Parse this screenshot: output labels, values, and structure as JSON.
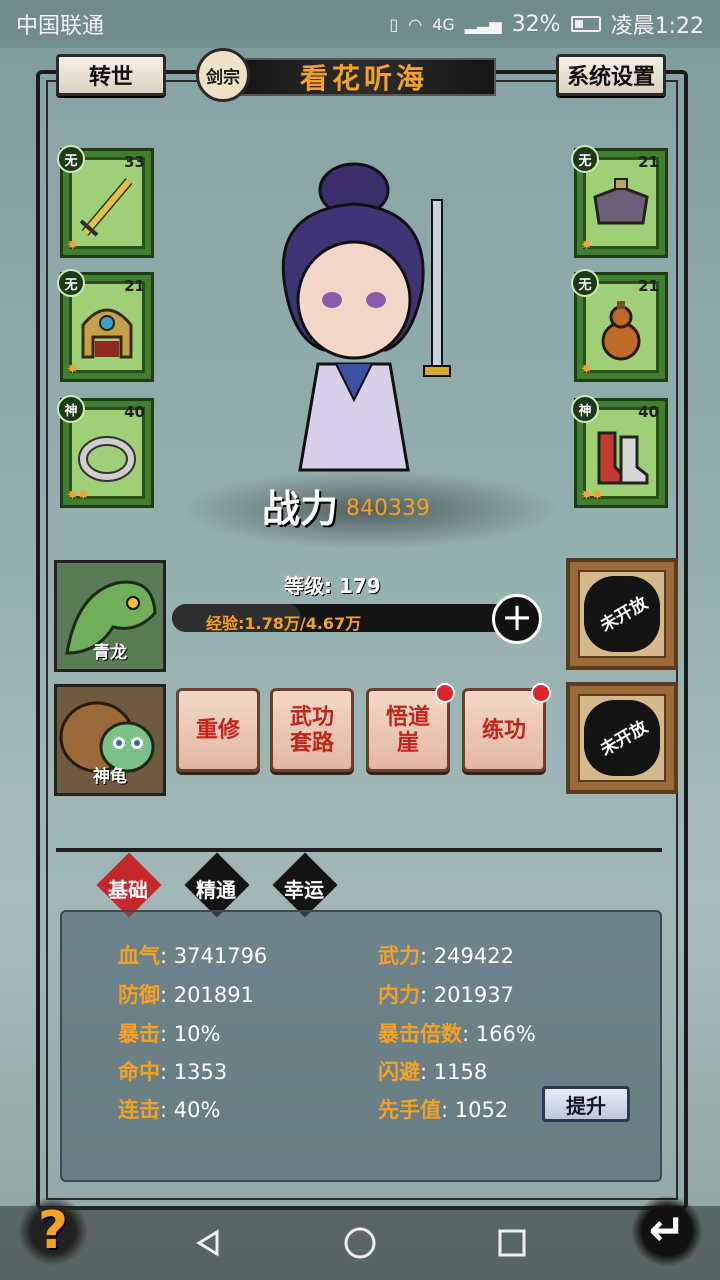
{
  "status_bar": {
    "carrier": "中国联通",
    "network": "4G",
    "battery": "32%",
    "time": "凌晨1:22"
  },
  "header": {
    "rebirth_label": "转世",
    "sect_label": "剑宗",
    "character_name": "看花听海",
    "settings_label": "系统设置"
  },
  "equipment": {
    "left": [
      {
        "rank": "无",
        "level": "33",
        "item": "sword-icon",
        "stars": 1
      },
      {
        "rank": "无",
        "level": "21",
        "item": "helmet-icon",
        "stars": 1
      },
      {
        "rank": "神",
        "level": "40",
        "item": "ring-icon",
        "stars": 2
      }
    ],
    "right": [
      {
        "rank": "无",
        "level": "21",
        "item": "armor-icon",
        "stars": 1
      },
      {
        "rank": "无",
        "level": "21",
        "item": "gourd-icon",
        "stars": 1
      },
      {
        "rank": "神",
        "level": "40",
        "item": "boots-icon",
        "stars": 2
      }
    ]
  },
  "power": {
    "label": "战力",
    "value": "840339"
  },
  "level": {
    "text": "等级: 179",
    "exp_text": "经验:1.78万/4.67万",
    "exp_progress": 0.38
  },
  "pets": [
    {
      "name": "青龙",
      "icon": "dragon-icon"
    },
    {
      "name": "神龟",
      "icon": "turtle-icon"
    }
  ],
  "actions": [
    {
      "label": "重修",
      "dot": false
    },
    {
      "label": "武功套路",
      "dot": false
    },
    {
      "label": "悟道崖",
      "dot": true
    },
    {
      "label": "练功",
      "dot": true
    }
  ],
  "locked_slots": [
    {
      "label": "未开放"
    },
    {
      "label": "未开放"
    }
  ],
  "tabs": [
    {
      "label": "基础",
      "active": true
    },
    {
      "label": "精通",
      "active": false
    },
    {
      "label": "幸运",
      "active": false
    }
  ],
  "stats": {
    "left": [
      {
        "key": "血气",
        "value": "3741796"
      },
      {
        "key": "防御",
        "value": "201891"
      },
      {
        "key": "暴击",
        "value": "10%"
      },
      {
        "key": "命中",
        "value": "1353"
      },
      {
        "key": "连击",
        "value": "40%"
      }
    ],
    "right": [
      {
        "key": "武力",
        "value": "249422"
      },
      {
        "key": "内力",
        "value": "201937"
      },
      {
        "key": "暴击倍数",
        "value": "166%"
      },
      {
        "key": "闪避",
        "value": "1158"
      },
      {
        "key": "先手值",
        "value": "1052"
      }
    ],
    "upgrade_label": "提升"
  },
  "bottom": {
    "help_label": "?",
    "back_label": "↵"
  },
  "colors": {
    "accent_orange": "#f4a126",
    "slot_green": "#9fd078",
    "danger_red": "#e2242a"
  }
}
